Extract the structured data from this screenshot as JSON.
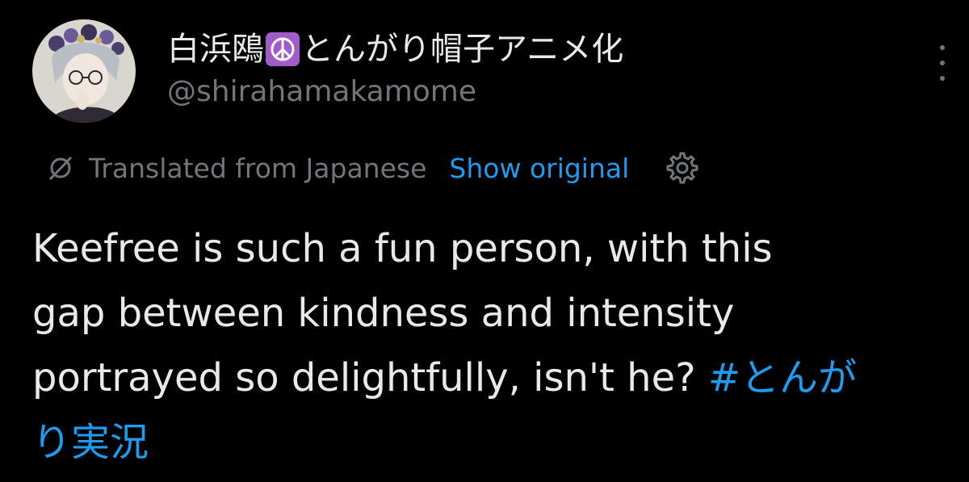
{
  "author": {
    "display_name_prefix": "白浜鴎",
    "emoji_symbol": "☮",
    "display_name_suffix": "とんがり帽子アニメ化",
    "handle": "@shirahamakamome"
  },
  "translation": {
    "label": "Translated from Japanese",
    "show_original": "Show original"
  },
  "tweet": {
    "line1": "Keefree is such a fun person, with this",
    "line2": "gap between kindness and intensity",
    "line3": "portrayed so delightfully, isn't he? ",
    "hashtag_part1": "#とんが",
    "hashtag_part2": "り実況"
  },
  "colors": {
    "background": "#000000",
    "text": "#e7e9ea",
    "secondary": "#71767b",
    "link": "#1d9bf0",
    "emoji_bg": "#a25cc9"
  },
  "icons": {
    "more": "more-vertical-icon",
    "translate": "translate-icon",
    "settings": "gear-icon"
  }
}
